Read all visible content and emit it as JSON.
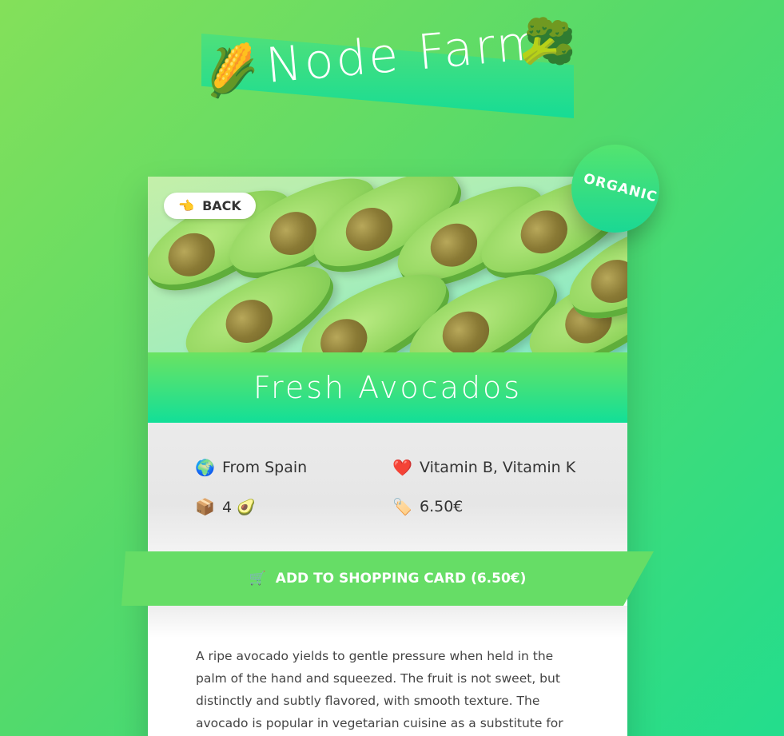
{
  "header": {
    "title": "Node Farm",
    "left_icon": "🌽",
    "right_icon": "🥦"
  },
  "product": {
    "badge": "ORGANIC",
    "back_label": "BACK",
    "back_icon": "👈",
    "image": "avocados",
    "name": "Fresh Avocados",
    "origin_icon": "🌍",
    "origin": "From Spain",
    "nutrients_icon": "❤️",
    "nutrients": "Vitamin B, Vitamin K",
    "quantity_icon": "📦",
    "quantity": "4 🥑",
    "price_icon": "🏷️",
    "price": "6.50€",
    "cart_icon": "🛒",
    "add_label": "ADD TO SHOPPING CARD (6.50€)",
    "description": "A ripe avocado yields to gentle pressure when held in the palm of the hand and squeezed. The fruit is not sweet, but distinctly and subtly flavored, with smooth texture. The avocado is popular in vegetarian cuisine as a substitute for meats in sandwiches and"
  },
  "colors": {
    "accent": "#66dd66",
    "accent_dark": "#12df98",
    "background_start": "#84e05a",
    "background_end": "#23dd8d"
  }
}
